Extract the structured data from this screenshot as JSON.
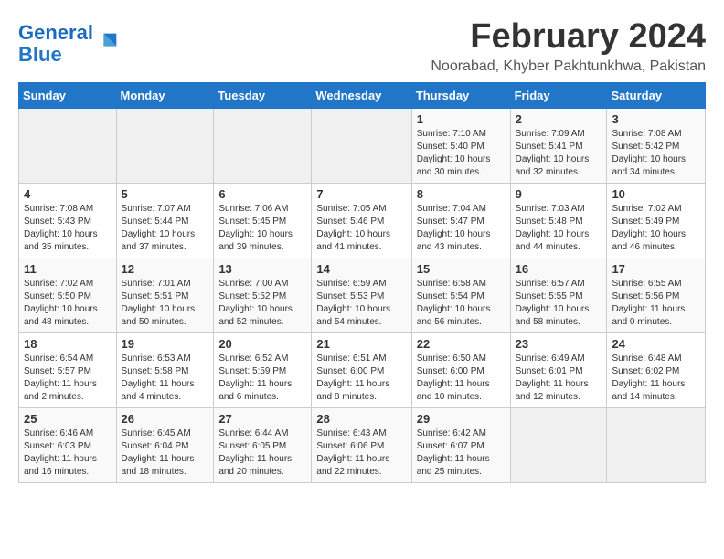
{
  "logo": {
    "line1": "General",
    "line2": "Blue"
  },
  "title": "February 2024",
  "location": "Noorabad, Khyber Pakhtunkhwa, Pakistan",
  "days_of_week": [
    "Sunday",
    "Monday",
    "Tuesday",
    "Wednesday",
    "Thursday",
    "Friday",
    "Saturday"
  ],
  "weeks": [
    [
      {
        "day": "",
        "info": ""
      },
      {
        "day": "",
        "info": ""
      },
      {
        "day": "",
        "info": ""
      },
      {
        "day": "",
        "info": ""
      },
      {
        "day": "1",
        "info": "Sunrise: 7:10 AM\nSunset: 5:40 PM\nDaylight: 10 hours\nand 30 minutes."
      },
      {
        "day": "2",
        "info": "Sunrise: 7:09 AM\nSunset: 5:41 PM\nDaylight: 10 hours\nand 32 minutes."
      },
      {
        "day": "3",
        "info": "Sunrise: 7:08 AM\nSunset: 5:42 PM\nDaylight: 10 hours\nand 34 minutes."
      }
    ],
    [
      {
        "day": "4",
        "info": "Sunrise: 7:08 AM\nSunset: 5:43 PM\nDaylight: 10 hours\nand 35 minutes."
      },
      {
        "day": "5",
        "info": "Sunrise: 7:07 AM\nSunset: 5:44 PM\nDaylight: 10 hours\nand 37 minutes."
      },
      {
        "day": "6",
        "info": "Sunrise: 7:06 AM\nSunset: 5:45 PM\nDaylight: 10 hours\nand 39 minutes."
      },
      {
        "day": "7",
        "info": "Sunrise: 7:05 AM\nSunset: 5:46 PM\nDaylight: 10 hours\nand 41 minutes."
      },
      {
        "day": "8",
        "info": "Sunrise: 7:04 AM\nSunset: 5:47 PM\nDaylight: 10 hours\nand 43 minutes."
      },
      {
        "day": "9",
        "info": "Sunrise: 7:03 AM\nSunset: 5:48 PM\nDaylight: 10 hours\nand 44 minutes."
      },
      {
        "day": "10",
        "info": "Sunrise: 7:02 AM\nSunset: 5:49 PM\nDaylight: 10 hours\nand 46 minutes."
      }
    ],
    [
      {
        "day": "11",
        "info": "Sunrise: 7:02 AM\nSunset: 5:50 PM\nDaylight: 10 hours\nand 48 minutes."
      },
      {
        "day": "12",
        "info": "Sunrise: 7:01 AM\nSunset: 5:51 PM\nDaylight: 10 hours\nand 50 minutes."
      },
      {
        "day": "13",
        "info": "Sunrise: 7:00 AM\nSunset: 5:52 PM\nDaylight: 10 hours\nand 52 minutes."
      },
      {
        "day": "14",
        "info": "Sunrise: 6:59 AM\nSunset: 5:53 PM\nDaylight: 10 hours\nand 54 minutes."
      },
      {
        "day": "15",
        "info": "Sunrise: 6:58 AM\nSunset: 5:54 PM\nDaylight: 10 hours\nand 56 minutes."
      },
      {
        "day": "16",
        "info": "Sunrise: 6:57 AM\nSunset: 5:55 PM\nDaylight: 10 hours\nand 58 minutes."
      },
      {
        "day": "17",
        "info": "Sunrise: 6:55 AM\nSunset: 5:56 PM\nDaylight: 11 hours\nand 0 minutes."
      }
    ],
    [
      {
        "day": "18",
        "info": "Sunrise: 6:54 AM\nSunset: 5:57 PM\nDaylight: 11 hours\nand 2 minutes."
      },
      {
        "day": "19",
        "info": "Sunrise: 6:53 AM\nSunset: 5:58 PM\nDaylight: 11 hours\nand 4 minutes."
      },
      {
        "day": "20",
        "info": "Sunrise: 6:52 AM\nSunset: 5:59 PM\nDaylight: 11 hours\nand 6 minutes."
      },
      {
        "day": "21",
        "info": "Sunrise: 6:51 AM\nSunset: 6:00 PM\nDaylight: 11 hours\nand 8 minutes."
      },
      {
        "day": "22",
        "info": "Sunrise: 6:50 AM\nSunset: 6:00 PM\nDaylight: 11 hours\nand 10 minutes."
      },
      {
        "day": "23",
        "info": "Sunrise: 6:49 AM\nSunset: 6:01 PM\nDaylight: 11 hours\nand 12 minutes."
      },
      {
        "day": "24",
        "info": "Sunrise: 6:48 AM\nSunset: 6:02 PM\nDaylight: 11 hours\nand 14 minutes."
      }
    ],
    [
      {
        "day": "25",
        "info": "Sunrise: 6:46 AM\nSunset: 6:03 PM\nDaylight: 11 hours\nand 16 minutes."
      },
      {
        "day": "26",
        "info": "Sunrise: 6:45 AM\nSunset: 6:04 PM\nDaylight: 11 hours\nand 18 minutes."
      },
      {
        "day": "27",
        "info": "Sunrise: 6:44 AM\nSunset: 6:05 PM\nDaylight: 11 hours\nand 20 minutes."
      },
      {
        "day": "28",
        "info": "Sunrise: 6:43 AM\nSunset: 6:06 PM\nDaylight: 11 hours\nand 22 minutes."
      },
      {
        "day": "29",
        "info": "Sunrise: 6:42 AM\nSunset: 6:07 PM\nDaylight: 11 hours\nand 25 minutes."
      },
      {
        "day": "",
        "info": ""
      },
      {
        "day": "",
        "info": ""
      }
    ]
  ]
}
